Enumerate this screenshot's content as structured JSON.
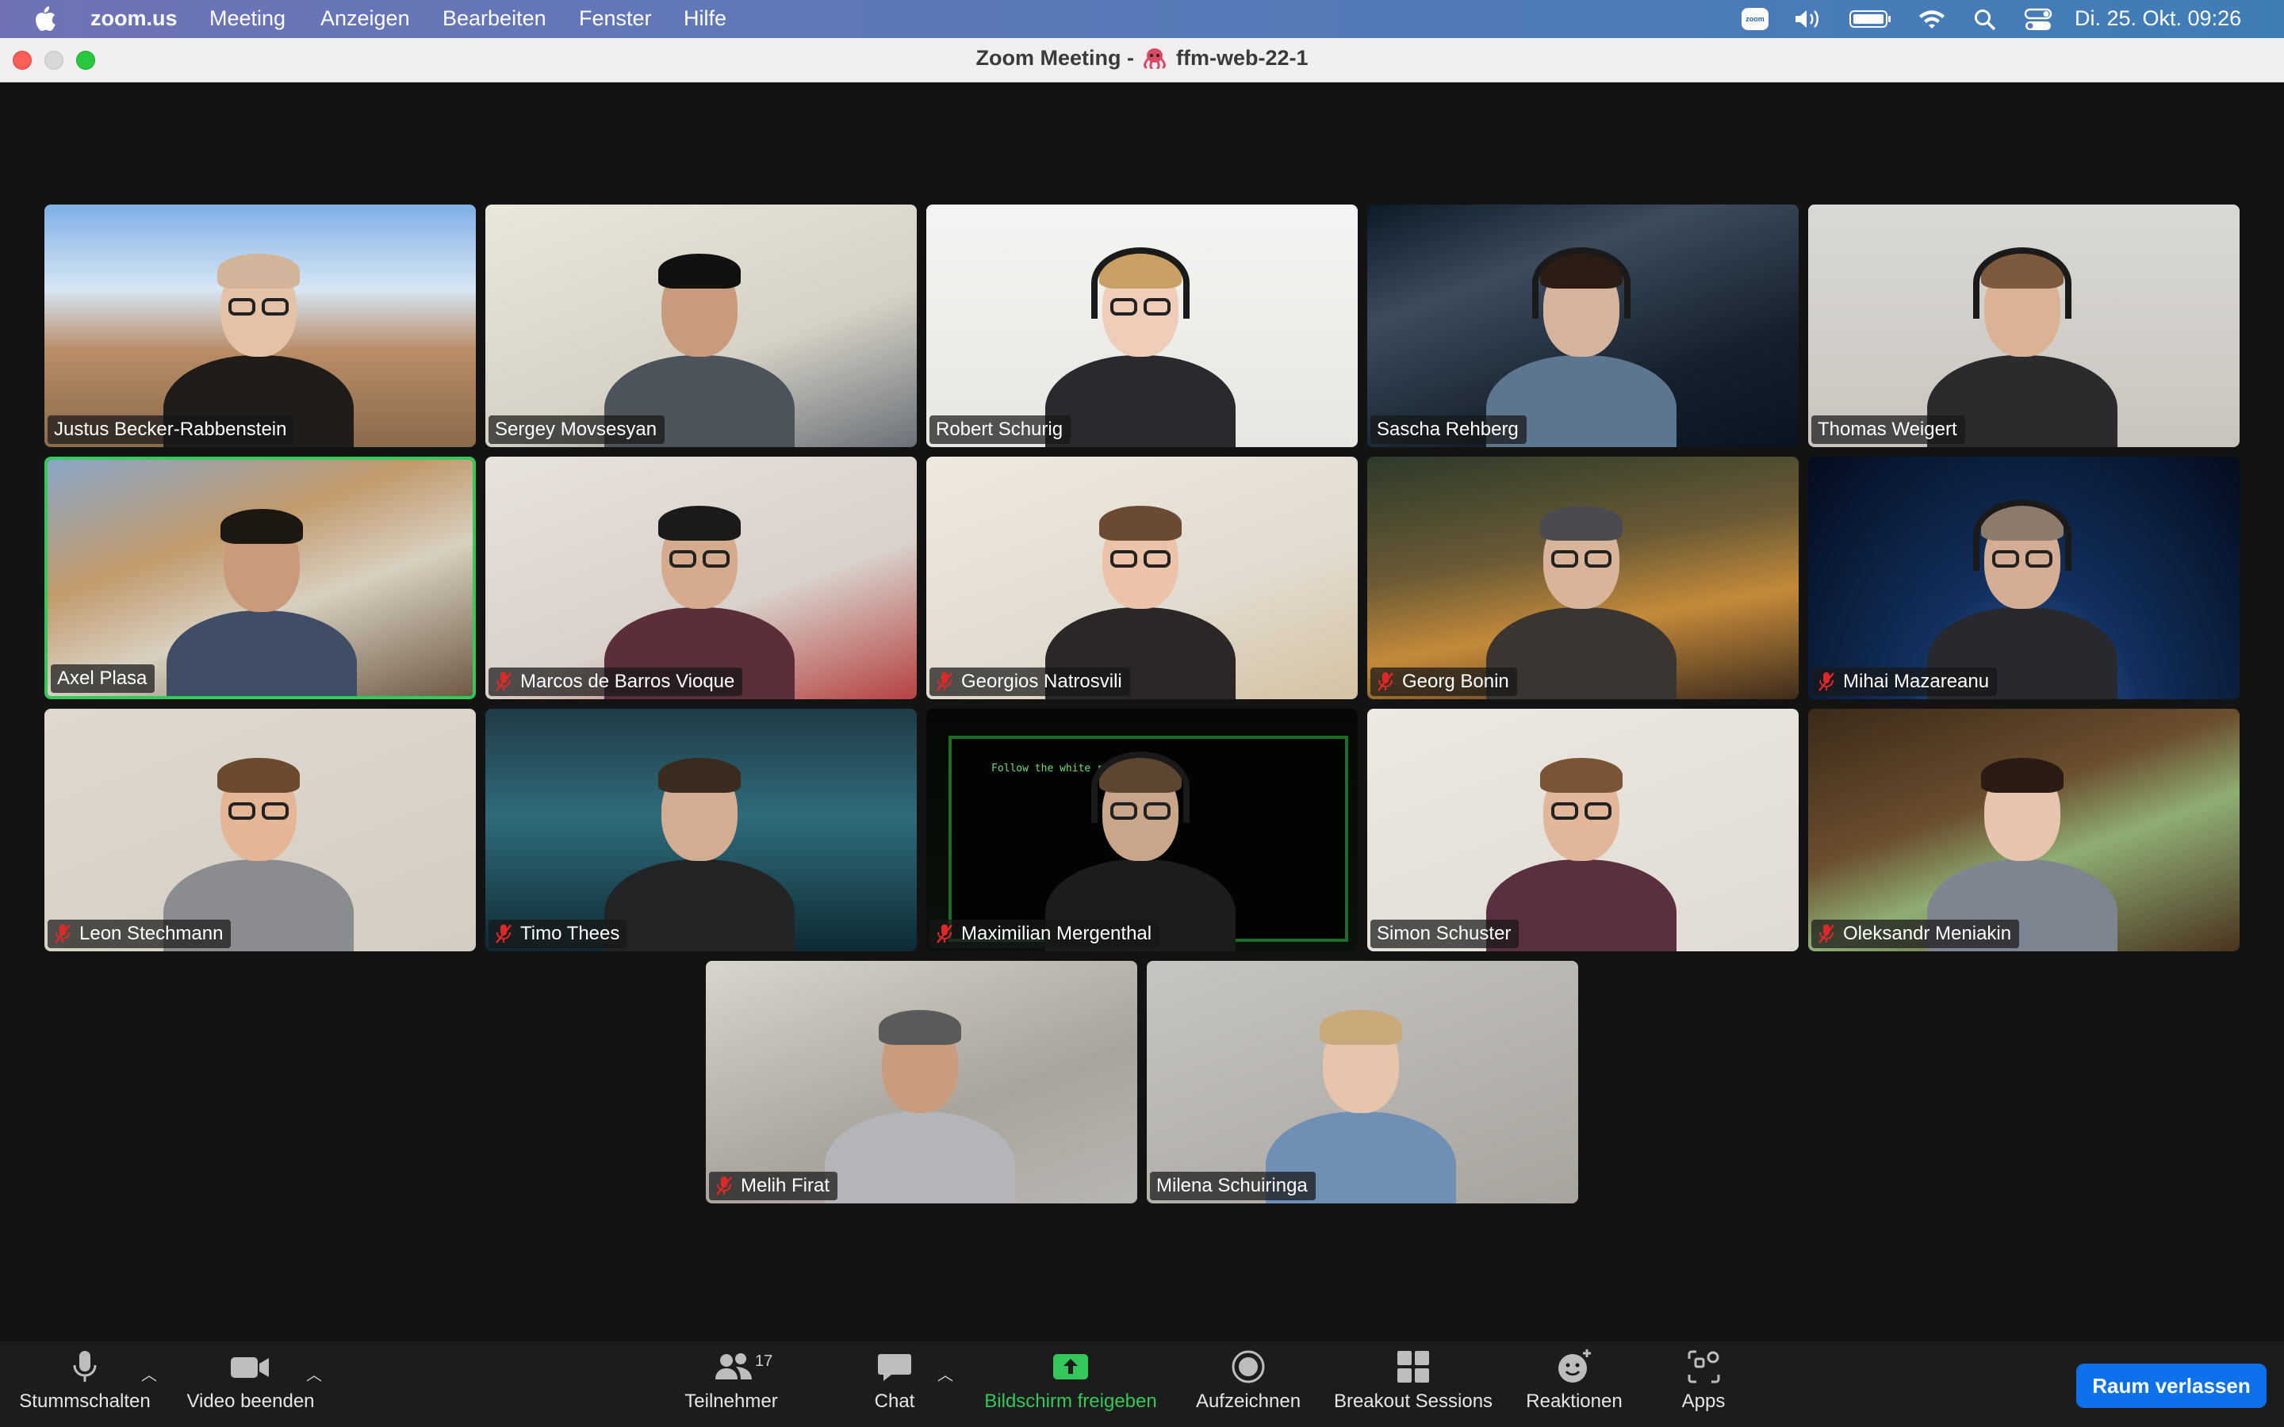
{
  "menubar": {
    "app_name": "zoom.us",
    "menus": [
      "Meeting",
      "Anzeigen",
      "Bearbeiten",
      "Fenster",
      "Hilfe"
    ],
    "clock": "Di. 25. Okt. 09:26",
    "status_icons": [
      "zoom-icon",
      "volume-icon",
      "battery-icon",
      "wifi-icon",
      "spotlight-icon",
      "control-center-icon"
    ]
  },
  "window": {
    "title_prefix": "Zoom Meeting -",
    "title_suffix": "ffm-web-22-1",
    "title_icon": "octopus-emoji"
  },
  "participants": [
    {
      "name": "Justus Becker-Rabbenstein",
      "muted": false,
      "speaking": false
    },
    {
      "name": "Sergey Movsesyan",
      "muted": false,
      "speaking": false
    },
    {
      "name": "Robert Schurig",
      "muted": false,
      "speaking": false
    },
    {
      "name": "Sascha Rehberg",
      "muted": false,
      "speaking": false
    },
    {
      "name": "Thomas Weigert",
      "muted": false,
      "speaking": false
    },
    {
      "name": "Axel Plasa",
      "muted": false,
      "speaking": true
    },
    {
      "name": "Marcos de Barros Vioque",
      "muted": true,
      "speaking": false
    },
    {
      "name": "Georgios Natrosvili",
      "muted": true,
      "speaking": false
    },
    {
      "name": "Georg Bonin",
      "muted": true,
      "speaking": false
    },
    {
      "name": "Mihai Mazareanu",
      "muted": true,
      "speaking": false
    },
    {
      "name": "Leon Stechmann",
      "muted": true,
      "speaking": false
    },
    {
      "name": "Timo Thees",
      "muted": true,
      "speaking": false
    },
    {
      "name": "Maximilian Mergenthal",
      "muted": true,
      "speaking": false
    },
    {
      "name": "Simon Schuster",
      "muted": false,
      "speaking": false
    },
    {
      "name": "Oleksandr Meniakin",
      "muted": true,
      "speaking": false
    },
    {
      "name": "Melih Firat",
      "muted": true,
      "speaking": false
    },
    {
      "name": "Milena Schuiringa",
      "muted": false,
      "speaking": false
    }
  ],
  "screen_text": {
    "matrix_tile": "Follow the white rabbit"
  },
  "toolbar": {
    "mute": "Stummschalten",
    "video": "Video beenden",
    "participants": "Teilnehmer",
    "participants_count": "17",
    "chat": "Chat",
    "share": "Bildschirm freigeben",
    "record": "Aufzeichnen",
    "breakout": "Breakout Sessions",
    "reactions": "Reaktionen",
    "apps": "Apps",
    "leave": "Raum verlassen"
  },
  "colors": {
    "share_green": "#34c759",
    "leave_blue": "#0e71eb",
    "active_speaker_border": "#34c759",
    "muted_red": "#e02828"
  }
}
